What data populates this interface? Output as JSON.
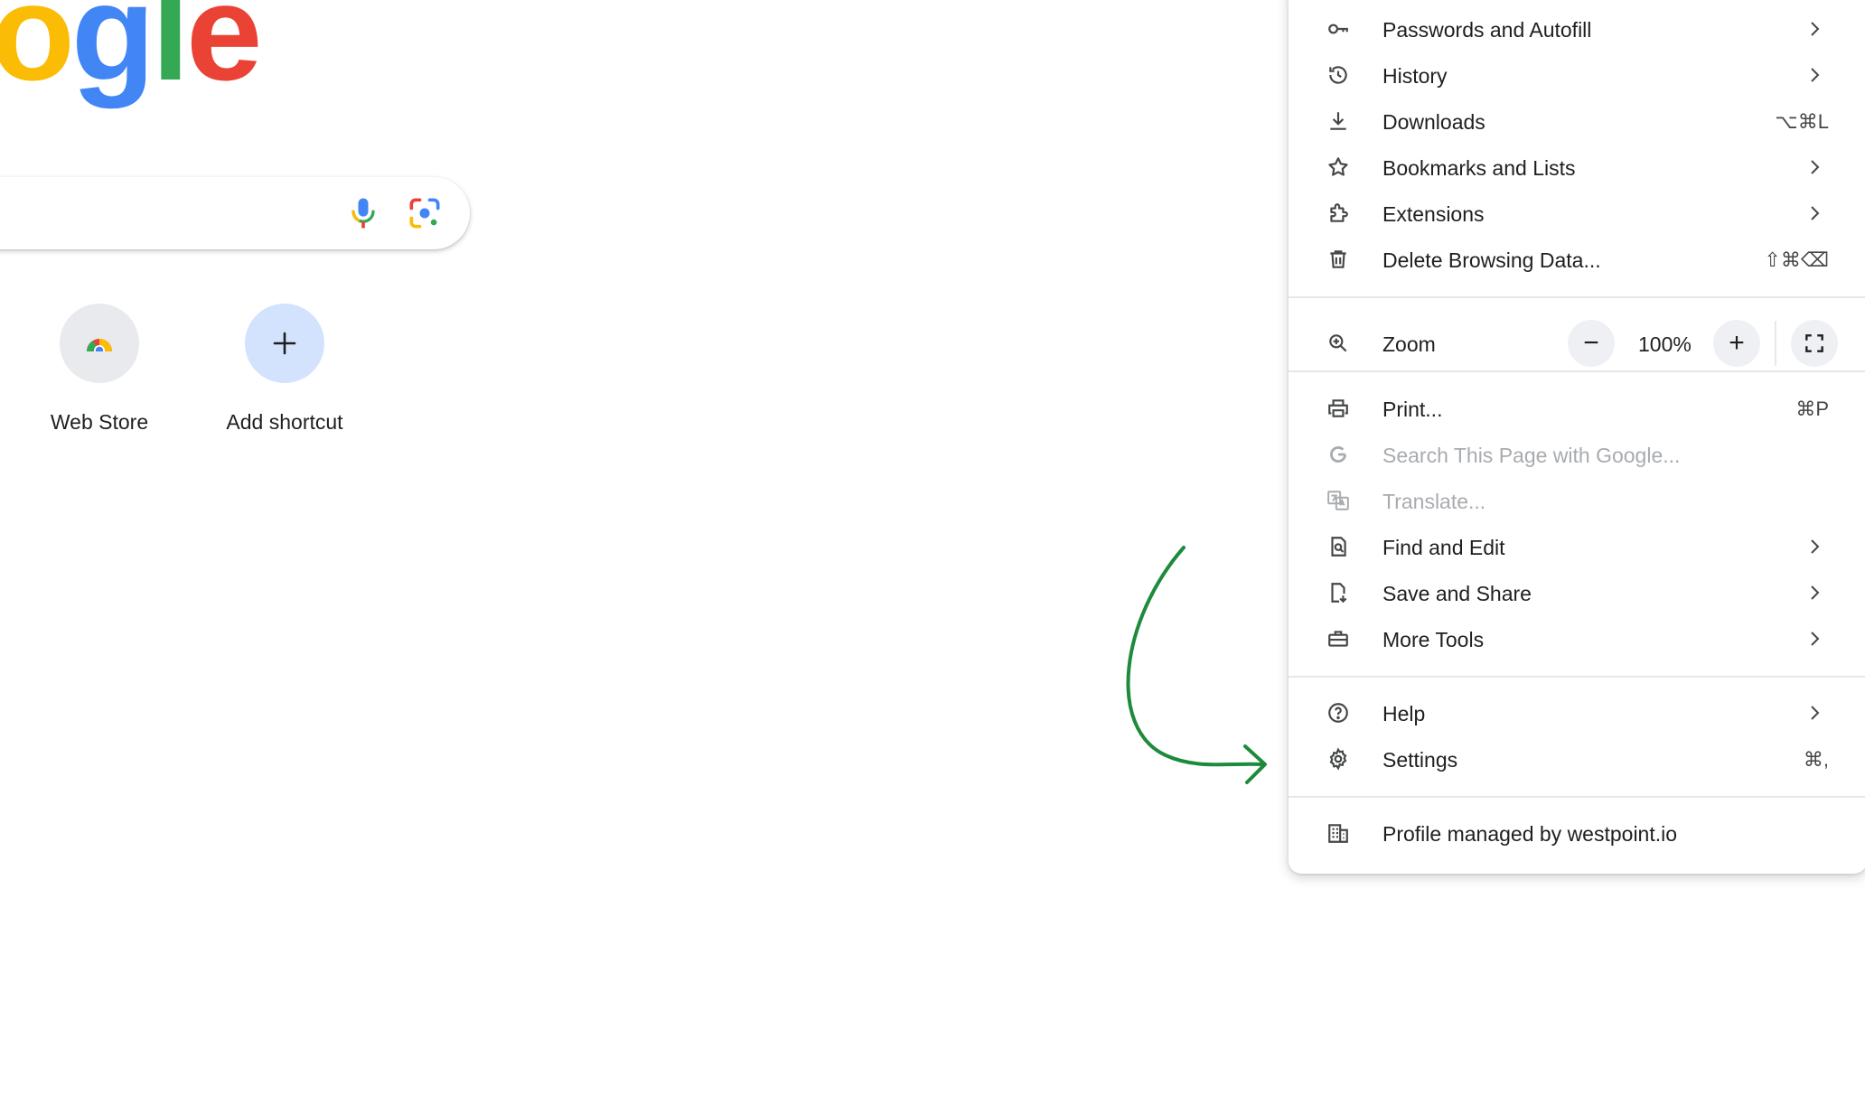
{
  "logo": {
    "letters": [
      {
        "char": "o",
        "color": "#fbbc05"
      },
      {
        "char": "g",
        "color": "#4285f4"
      },
      {
        "char": "l",
        "color": "#34a853"
      },
      {
        "char": "e",
        "color": "#ea4335"
      }
    ]
  },
  "search": {
    "mic_icon": "microphone-icon",
    "lens_icon": "google-lens-icon"
  },
  "shortcuts": [
    {
      "label": "Web Store",
      "icon": "chrome-web-store-icon"
    },
    {
      "label": "Add shortcut",
      "icon": "plus-icon"
    }
  ],
  "menu": {
    "items_top": [
      {
        "label": "Passwords and Autofill",
        "icon": "key-icon",
        "submenu": true,
        "shortcut": ""
      },
      {
        "label": "History",
        "icon": "history-icon",
        "submenu": true,
        "shortcut": ""
      },
      {
        "label": "Downloads",
        "icon": "download-icon",
        "submenu": false,
        "shortcut": "⌥⌘L"
      },
      {
        "label": "Bookmarks and Lists",
        "icon": "star-icon",
        "submenu": true,
        "shortcut": ""
      },
      {
        "label": "Extensions",
        "icon": "puzzle-icon",
        "submenu": true,
        "shortcut": ""
      },
      {
        "label": "Delete Browsing Data...",
        "icon": "trash-icon",
        "submenu": false,
        "shortcut": "⇧⌘⌫"
      }
    ],
    "zoom": {
      "label": "Zoom",
      "value": "100%",
      "decrease": "−",
      "increase": "+",
      "icon": "zoom-icon",
      "fullscreen_icon": "fullscreen-icon"
    },
    "items_middle": [
      {
        "label": "Print...",
        "icon": "printer-icon",
        "submenu": false,
        "shortcut": "⌘P",
        "disabled": false
      },
      {
        "label": "Search This Page with Google...",
        "icon": "google-g-icon",
        "submenu": false,
        "shortcut": "",
        "disabled": true
      },
      {
        "label": "Translate...",
        "icon": "translate-icon",
        "submenu": false,
        "shortcut": "",
        "disabled": true
      },
      {
        "label": "Find and Edit",
        "icon": "find-page-icon",
        "submenu": true,
        "shortcut": "",
        "disabled": false
      },
      {
        "label": "Save and Share",
        "icon": "save-share-icon",
        "submenu": true,
        "shortcut": "",
        "disabled": false
      },
      {
        "label": "More Tools",
        "icon": "toolbox-icon",
        "submenu": true,
        "shortcut": "",
        "disabled": false
      }
    ],
    "items_bottom": [
      {
        "label": "Help",
        "icon": "help-icon",
        "submenu": true,
        "shortcut": ""
      },
      {
        "label": "Settings",
        "icon": "gear-icon",
        "submenu": false,
        "shortcut": "⌘,"
      }
    ],
    "managed": {
      "label": "Profile managed by westpoint.io",
      "icon": "building-icon"
    }
  },
  "annotation": {
    "arrow_color": "#1e8a3c",
    "icon": "green-arrow-annotation"
  }
}
